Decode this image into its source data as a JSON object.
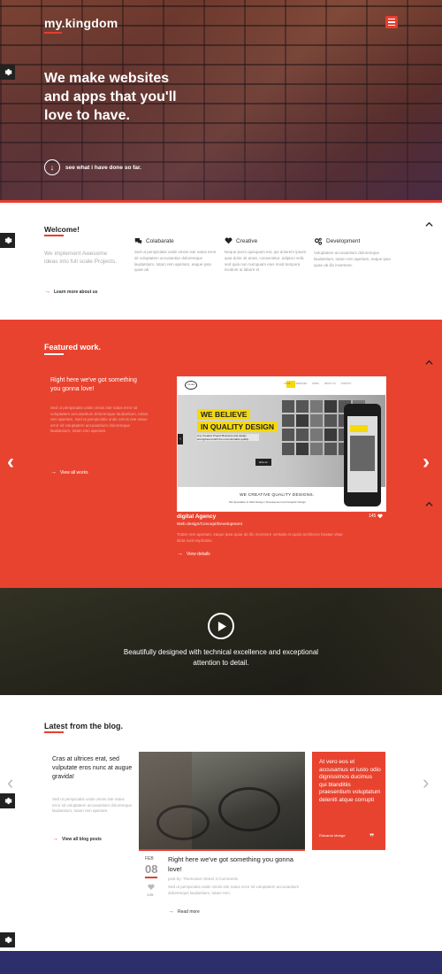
{
  "header": {
    "logo": "my.kingdom",
    "menu_icon": "hamburger-icon"
  },
  "hero": {
    "headline": "We make websites and apps that you'll love to have.",
    "cta": "see what i have done so far."
  },
  "welcome": {
    "title": "Welcome!",
    "intro": "We implement Awesome ideas into full scale Projects.",
    "link": "Learn more about us",
    "features": [
      {
        "icon": "chat-icon",
        "title": "Colabarate",
        "text": "Sed ut perspiciatis unde omnis iste natus error sit voluptatem accusantiur doloremque laudantium, totam rem aperiam, eaque ipsa quae ab"
      },
      {
        "icon": "heart-icon",
        "title": "Creative",
        "text": "Neque porro quisquam est, qui dolorem ipsum quia dolor sit amet, consectetur, adipisci velit, sed quia non numquam eius modi tempora incidunt ut labore et"
      },
      {
        "icon": "cogs-icon",
        "title": "Development",
        "text": "Voluptatem accusantium doloremque laudantium, totam rem aperiam, eaque ipsa quae ab illo inventore."
      }
    ]
  },
  "featured": {
    "title": "Featured work.",
    "headline": "Right here we've got something you gonna love!",
    "text": "Sed ut perspiciatis unde omnis iste natus error sit voluptatem accusantium doloremque laudantium, totam rem aperiam. Sed ut perspiciatis unde omnis iste natus error sit voluptatem accusantium doloremque laudantium, totam rem aperiam.",
    "view_all": "View all works",
    "project_name": "digital Agency",
    "project_subtitle": "Web design/Concept/Development",
    "project_likes": "145",
    "project_desc": "Totam rem aperiam, eaque ipsa quae ab illo inventore veritatis et quasi architecto beatae vitae dicta sunt explicabo.",
    "view_details": "View details",
    "mockup": {
      "badge": "ORIGAMI",
      "nav": [
        "HOME",
        "SERVICES",
        "WORK",
        "ABOUT US",
        "CONTACT"
      ],
      "line1": "WE BELIEVE",
      "line2": "IN QUALITY DESIGN",
      "sub": "Any Creative Project Business and design strengthened with the uncomfortable quality.",
      "button": "Hire us",
      "caption": "WE CREATIVE QUALITY DESIGNS.",
      "caption2": "We Specialize In Web Design / Development and Graphic Design"
    }
  },
  "video": {
    "text": "Beautifully designed with technical excellence and exceptional attention to detail."
  },
  "blog": {
    "title": "Latest from the blog.",
    "headline": "Cras at ultrices erat, sed vulputate eros nunc at augue gravida!",
    "text": "Sed ut perspiciatis unde omnis iste natus error sit voluptatem accusantium doloremque laudantium, totam rem aperiam.",
    "link": "View all blog posts",
    "quote": "At vero eos et accusamus et iusto odio dignissimos ducimus qui blanditiis praesentium voluptatum deleniti atque corrupti",
    "quote_author": "Ridvardo Mortge",
    "post": {
      "month": "FEB",
      "day": "08",
      "likes": "145",
      "title": "Right here we've got something you gonna love!",
      "meta": "post by: Themosive  Street  3 Comments",
      "text": "Sed ut perspiciatis unde omnis iste natus error sit voluptatem accusantium doloremque laudantium, totam rem.",
      "read_more": "Read more"
    }
  },
  "colors": {
    "accent": "#e8432f",
    "dark": "#222222",
    "footer": "#2c2f6b"
  }
}
